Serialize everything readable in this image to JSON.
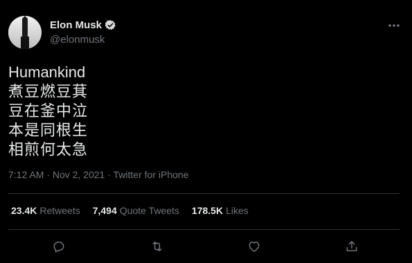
{
  "author": {
    "display_name": "Elon Musk",
    "handle": "@elonmusk",
    "verified": true
  },
  "tweet": {
    "lines": [
      "Humankind",
      "煮豆燃豆萁",
      "豆在釜中泣",
      "本是同根生",
      "相煎何太急"
    ]
  },
  "meta": {
    "time": "7:12 AM",
    "separator": "·",
    "date": "Nov 2, 2021",
    "source": "Twitter for iPhone"
  },
  "stats": {
    "retweets_count": "23.4K",
    "retweets_label": "Retweets",
    "quote_count": "7,494",
    "quote_label": "Quote Tweets",
    "likes_count": "178.5K",
    "likes_label": "Likes"
  },
  "icons": {
    "verified": "verified-badge-icon",
    "more": "more-options-icon",
    "reply": "reply-icon",
    "retweet": "retweet-icon",
    "like": "heart-icon",
    "share": "share-icon"
  },
  "colors": {
    "background": "#000000",
    "text_primary": "#e7e9ea",
    "text_secondary": "#71767b",
    "divider": "#2f3336",
    "verified": "#d9d9d9"
  }
}
